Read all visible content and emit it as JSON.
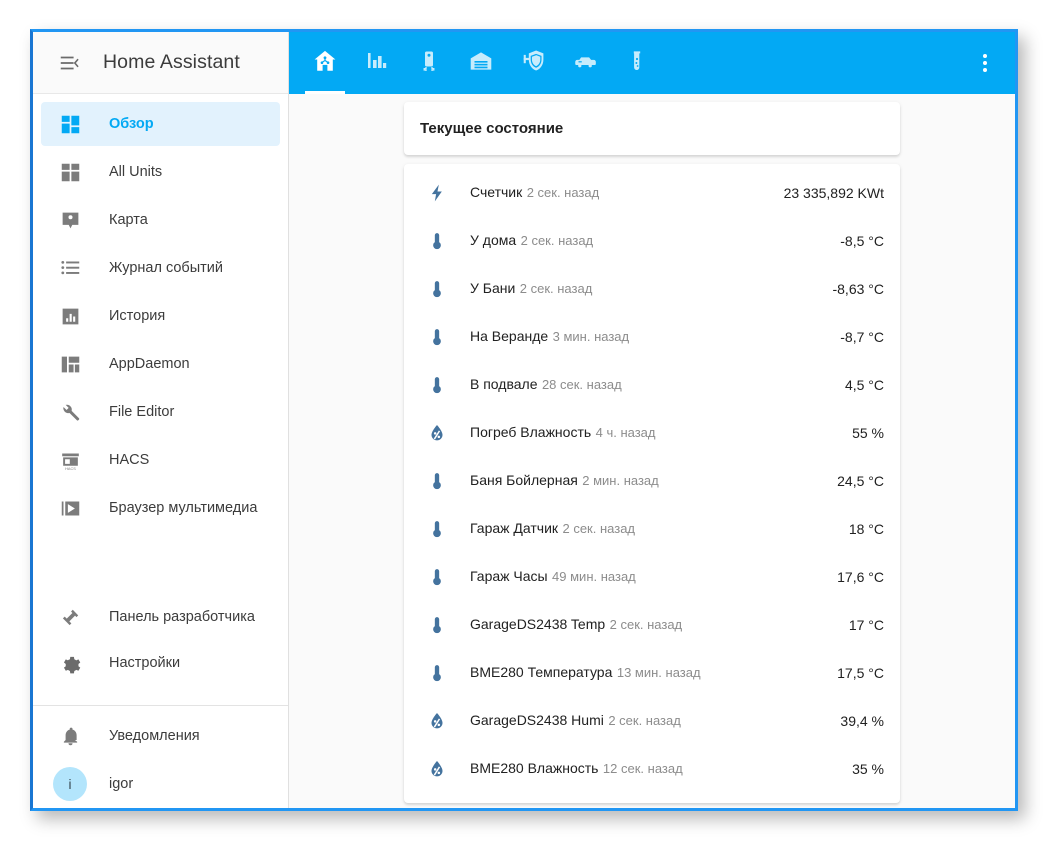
{
  "window": {
    "border_color": "#2196f3",
    "accent_color": "#03a9f4"
  },
  "sidebar": {
    "title": "Home Assistant",
    "menu_icon": "menu-collapse-icon",
    "items": [
      {
        "label": "Обзор",
        "icon": "view-dashboard-icon",
        "active": true
      },
      {
        "label": "All Units",
        "icon": "view-quilt-icon",
        "active": false
      },
      {
        "label": "Карта",
        "icon": "account-badge-icon",
        "active": false
      },
      {
        "label": "Журнал событий",
        "icon": "format-list-icon",
        "active": false
      },
      {
        "label": "История",
        "icon": "chart-box-icon",
        "active": false
      },
      {
        "label": "AppDaemon",
        "icon": "view-dashboard-variant-icon",
        "active": false
      },
      {
        "label": "File Editor",
        "icon": "wrench-icon",
        "active": false
      },
      {
        "label": "HACS",
        "icon": "storefront-icon",
        "active": false
      },
      {
        "label": "Браузер мультимедиа",
        "icon": "play-box-icon",
        "active": false
      }
    ],
    "bottom_items": [
      {
        "label": "Панель разработчика",
        "icon": "hammer-icon",
        "active": false
      },
      {
        "label": "Настройки",
        "icon": "cog-icon",
        "active": false
      }
    ],
    "footer_items": [
      {
        "label": "Уведомления",
        "icon": "bell-icon",
        "active": false
      }
    ],
    "user": {
      "label": "igor",
      "initial": "i",
      "avatar_color": "#b3e5fc"
    }
  },
  "toolbar": {
    "tabs": [
      {
        "icon": "home-automation-icon",
        "active": true
      },
      {
        "icon": "chart-bar-icon",
        "active": false
      },
      {
        "icon": "water-boiler-icon",
        "active": false
      },
      {
        "icon": "garage-icon",
        "active": false
      },
      {
        "icon": "shield-home-icon",
        "active": false
      },
      {
        "icon": "car-icon",
        "active": false
      },
      {
        "icon": "test-tube-icon",
        "active": false
      }
    ],
    "overflow_icon": "dots-vertical-icon"
  },
  "main": {
    "header_card": {
      "title": "Текущее состояние"
    },
    "entities": [
      {
        "name": "Счетчик",
        "last_changed": "2 сек. назад",
        "state": "23 335,892 KWt",
        "icon": "flash-icon"
      },
      {
        "name": "У дома",
        "last_changed": "2 сек. назад",
        "state": "-8,5 °C",
        "icon": "thermometer-icon"
      },
      {
        "name": "У Бани",
        "last_changed": "2 сек. назад",
        "state": "-8,63 °C",
        "icon": "thermometer-icon"
      },
      {
        "name": "На Веранде",
        "last_changed": "3 мин. назад",
        "state": "-8,7 °C",
        "icon": "thermometer-icon"
      },
      {
        "name": "В подвале",
        "last_changed": "28 сек. назад",
        "state": "4,5 °C",
        "icon": "thermometer-icon"
      },
      {
        "name": "Погреб Влажность",
        "last_changed": "4 ч. назад",
        "state": "55 %",
        "icon": "water-percent-icon"
      },
      {
        "name": "Баня Бойлерная",
        "last_changed": "2 мин. назад",
        "state": "24,5 °C",
        "icon": "thermometer-icon"
      },
      {
        "name": "Гараж Датчик",
        "last_changed": "2 сек. назад",
        "state": "18 °C",
        "icon": "thermometer-icon"
      },
      {
        "name": "Гараж Часы",
        "last_changed": "49 мин. назад",
        "state": "17,6 °C",
        "icon": "thermometer-icon"
      },
      {
        "name": "GarageDS2438 Temp",
        "last_changed": "2 сек. назад",
        "state": "17 °C",
        "icon": "thermometer-icon"
      },
      {
        "name": "BME280 Температура",
        "last_changed": "13 мин. назад",
        "state": "17,5 °C",
        "icon": "thermometer-icon"
      },
      {
        "name": "GarageDS2438 Humi",
        "last_changed": "2 сек. назад",
        "state": "39,4 %",
        "icon": "water-percent-icon"
      },
      {
        "name": "BME280 Влажность",
        "last_changed": "12 сек. назад",
        "state": "35 %",
        "icon": "water-percent-icon"
      }
    ]
  }
}
